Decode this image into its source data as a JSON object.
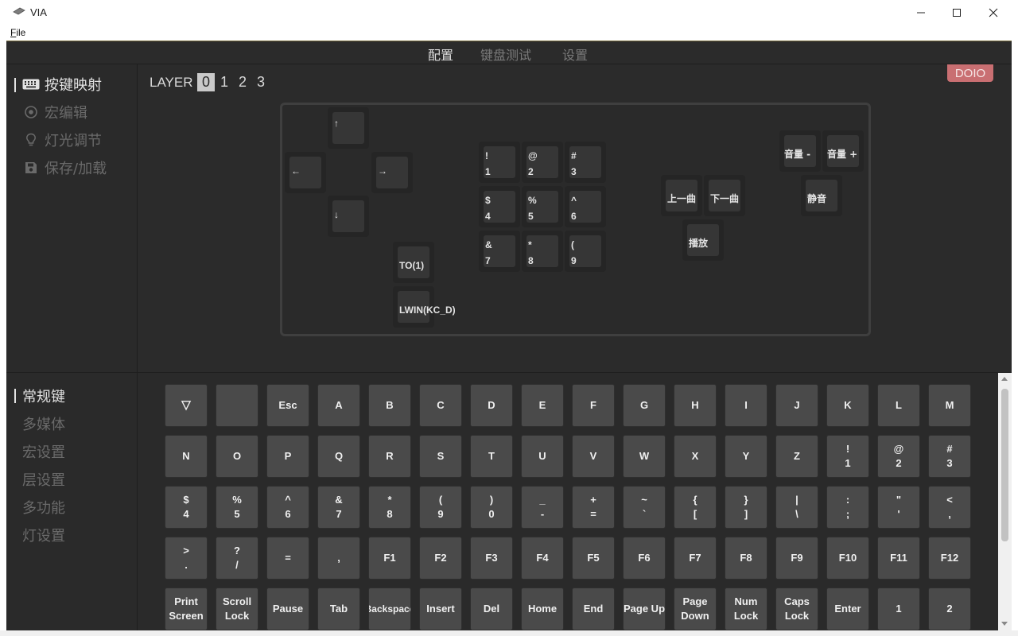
{
  "window": {
    "title": "VIA",
    "menu_file": "File",
    "icon": "keyboard-icon"
  },
  "topnav": {
    "tabs": [
      {
        "label": "配置",
        "active": true
      },
      {
        "label": "键盘测试",
        "active": false
      },
      {
        "label": "设置",
        "active": false
      }
    ]
  },
  "sidebar": {
    "items": [
      {
        "label": "按键映射",
        "icon": "keyboard-icon",
        "active": true
      },
      {
        "label": "宏编辑",
        "icon": "record-icon",
        "active": false
      },
      {
        "label": "灯光调节",
        "icon": "bulb-icon",
        "active": false
      },
      {
        "label": "保存/加载",
        "icon": "save-icon",
        "active": false
      }
    ]
  },
  "layers": {
    "label": "LAYER",
    "numbers": [
      "0",
      "1",
      "2",
      "3"
    ],
    "selected": "0"
  },
  "brand_badge": "DOIO",
  "keyboard": {
    "keys": [
      {
        "label": "↑"
      },
      {
        "label": "←"
      },
      {
        "label": "→"
      },
      {
        "label": "↓"
      },
      {
        "label": "TO(1)"
      },
      {
        "label": "LWIN(KC_D)"
      },
      {
        "label": "!\n1"
      },
      {
        "label": "@\n2"
      },
      {
        "label": "#\n3"
      },
      {
        "label": "$\n4"
      },
      {
        "label": "%\n5"
      },
      {
        "label": "^\n6"
      },
      {
        "label": "&\n7"
      },
      {
        "label": "*\n8"
      },
      {
        "label": "(\n9"
      },
      {
        "label": "上一曲"
      },
      {
        "label": "下一曲"
      },
      {
        "label": "播放"
      },
      {
        "label": "音量 -"
      },
      {
        "label": "音量 +"
      },
      {
        "label": "静音"
      }
    ]
  },
  "categories": {
    "items": [
      {
        "label": "常规键",
        "active": true
      },
      {
        "label": "多媒体",
        "active": false
      },
      {
        "label": "宏设置",
        "active": false
      },
      {
        "label": "层设置",
        "active": false
      },
      {
        "label": "多功能",
        "active": false
      },
      {
        "label": "灯设置",
        "active": false
      }
    ]
  },
  "keypicker": {
    "rows": [
      [
        "▽",
        "",
        "Esc",
        "A",
        "B",
        "C",
        "D",
        "E",
        "F",
        "G",
        "H",
        "I",
        "J",
        "K",
        "L",
        "M"
      ],
      [
        "N",
        "O",
        "P",
        "Q",
        "R",
        "S",
        "T",
        "U",
        "V",
        "W",
        "X",
        "Y",
        "Z",
        "!\n1",
        "@\n2",
        "#\n3"
      ],
      [
        "$\n4",
        "%\n5",
        "^\n6",
        "&\n7",
        "*\n8",
        "(\n9",
        ")\n0",
        "_\n-",
        "+\n=",
        "~\n`",
        "{\n[",
        "}\n]",
        "|\n\\",
        ":\n;",
        "\"\n'",
        "<\n,"
      ],
      [
        ">\n.",
        "?\n/",
        "=",
        ",",
        "F1",
        "F2",
        "F3",
        "F4",
        "F5",
        "F6",
        "F7",
        "F8",
        "F9",
        "F10",
        "F11",
        "F12"
      ],
      [
        "Print\nScreen",
        "Scroll\nLock",
        "Pause",
        "Tab",
        "Backspace",
        "Insert",
        "Del",
        "Home",
        "End",
        "Page Up",
        "Page\nDown",
        "Num\nLock",
        "Caps\nLock",
        "Enter",
        "1",
        "2"
      ]
    ]
  },
  "colors": {
    "background": "#2a2a2a",
    "key": "#4a4a4a",
    "badge": "#c96f72",
    "text": "#e2e2e2",
    "muted": "#6a6a6a"
  }
}
